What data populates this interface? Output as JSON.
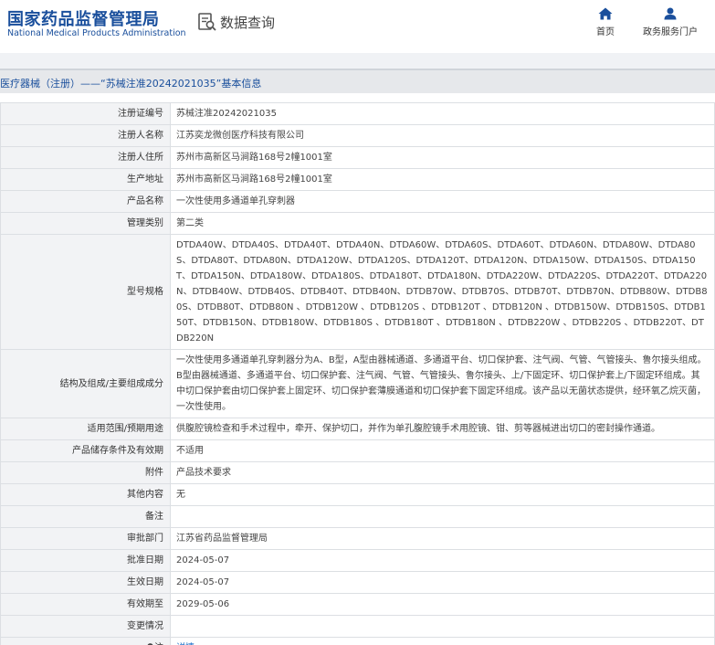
{
  "header": {
    "logo_cn": "国家药品监督管理局",
    "logo_en": "National Medical Products Administration",
    "query_label": "数据查询",
    "nav": [
      {
        "label": "首页",
        "icon": "home-icon"
      },
      {
        "label": "政务服务门户",
        "icon": "user-icon"
      }
    ]
  },
  "colors": {
    "brand": "#1a4f9c",
    "link": "#1a6fc9",
    "label_bg": "#f2f3f5",
    "crumb_bg": "#e6e8eb"
  },
  "breadcrumb": "医疗器械（注册）——“苏械注准20242021035”基本信息",
  "rows": [
    {
      "label": "注册证编号",
      "value": "苏械注准20242021035"
    },
    {
      "label": "注册人名称",
      "value": "江苏奕龙微创医疗科技有限公司"
    },
    {
      "label": "注册人住所",
      "value": "苏州市高新区马涧路168号2幢1001室"
    },
    {
      "label": "生产地址",
      "value": "苏州市高新区马涧路168号2幢1001室"
    },
    {
      "label": "产品名称",
      "value": "一次性使用多通道单孔穿刺器"
    },
    {
      "label": "管理类别",
      "value": "第二类"
    },
    {
      "label": "型号规格",
      "value": "DTDA40W、DTDA40S、DTDA40T、DTDA40N、DTDA60W、DTDA60S、DTDA60T、DTDA60N、DTDA80W、DTDA80S、DTDA80T、DTDA80N、DTDA120W、DTDA120S、DTDA120T、DTDA120N、DTDA150W、DTDA150S、DTDA150T、DTDA150N、DTDA180W、DTDA180S、DTDA180T、DTDA180N、DTDA220W、DTDA220S、DTDA220T、DTDA220N、DTDB40W、DTDB40S、DTDB40T、DTDB40N、DTDB70W、DTDB70S、DTDB70T、DTDB70N、DTDB80W、DTDB80S、DTDB80T、DTDB80N 、DTDB120W 、DTDB120S 、DTDB120T 、DTDB120N 、DTDB150W、DTDB150S、DTDB150T、DTDB150N、DTDB180W、DTDB180S 、DTDB180T 、DTDB180N 、DTDB220W 、DTDB220S 、DTDB220T、DTDB220N"
    },
    {
      "label": "结构及组成/主要组成成分",
      "value": "一次性使用多通道单孔穿刺器分为A、B型，A型由器械通道、多通道平台、切口保护套、注气阀、气管、气管接头、鲁尔接头组成。B型由器械通道、多通道平台、切口保护套、注气阀、气管、气管接头、鲁尔接头、上/下固定环、切口保护套上/下固定环组成。其中切口保护套由切口保护套上固定环、切口保护套薄膜通道和切口保护套下固定环组成。该产品以无菌状态提供，经环氧乙烷灭菌，一次性使用。"
    },
    {
      "label": "适用范围/预期用途",
      "value": "供腹腔镜检查和手术过程中，牵开、保护切口，并作为单孔腹腔镜手术用腔镜、钳、剪等器械进出切口的密封操作通道。"
    },
    {
      "label": "产品储存条件及有效期",
      "value": "不适用"
    },
    {
      "label": "附件",
      "value": "产品技术要求"
    },
    {
      "label": "其他内容",
      "value": "无"
    },
    {
      "label": "备注",
      "value": ""
    },
    {
      "label": "审批部门",
      "value": "江苏省药品监督管理局"
    },
    {
      "label": "批准日期",
      "value": "2024-05-07"
    },
    {
      "label": "生效日期",
      "value": "2024-05-07"
    },
    {
      "label": "有效期至",
      "value": "2029-05-06"
    },
    {
      "label": "变更情况",
      "value": ""
    }
  ],
  "note_row": {
    "label": "注",
    "value": "详情",
    "icon": "location-pin-icon"
  }
}
